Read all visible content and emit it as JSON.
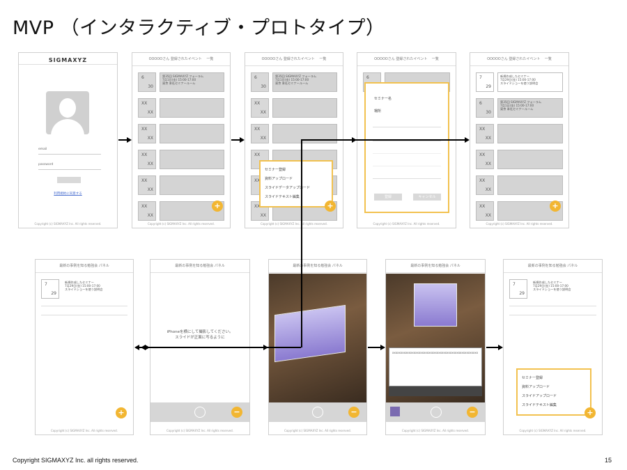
{
  "slide": {
    "title": "MVP （インタラクティブ・プロトタイプ）",
    "footer": "Copyright SIGMAXYZ Inc. all rights reserved.",
    "page_number": "15"
  },
  "login": {
    "logo": "SIGMAXYZ",
    "email_label": "email",
    "password_label": "password",
    "link": "利用規約に同意する",
    "copyright": "Copyright (c) SIGMAXYZ Inc. All rights reserved."
  },
  "list_screen": {
    "header": "OOOOOさん 登録されたイベント 　一覧",
    "event1": {
      "month": "6",
      "day": "30",
      "text": "第35回 SIGMAXYZ フォーラム\n7月1日(金) 15:00-17:00\n東京 本社セミナールーム"
    },
    "placeholder": {
      "month": "XX",
      "day": "XX"
    },
    "fab": "+",
    "copyright": "Copyright (c) SIGMAXYZ Inc. All rights reserved."
  },
  "menu_popup": {
    "items": [
      "セミナー登録",
      "資料アップロード",
      "スライドデータアップロード",
      "スライドテキスト編集"
    ]
  },
  "form_screen": {
    "label1": "セミナー名",
    "label2": "場所",
    "btn_ok": "登録",
    "btn_cancel": "キャンセル"
  },
  "list_screen_2": {
    "header": "OOOOOさん 登録されたイベント 　一覧",
    "event0": {
      "month": "7",
      "day": "29",
      "text": "新規作成したセミナー\n7月29日(金) 15:00-17:00\nスライドショーを使う説明会"
    },
    "event1": {
      "month": "6",
      "day": "30",
      "text": "第35回 SIGMAXYZ フォーラム\n7月1日(金) 15:00-17:00\n東京 本社セミナールーム"
    }
  },
  "detail_screen": {
    "header": "最新の事例を知る勉強会 パネル",
    "event": {
      "month": "7",
      "day": "29",
      "text": "新規作成したセミナー\n7月29日(金) 15:00-17:00\nスライドショーを使う説明会"
    },
    "fab": "+",
    "copyright": "Copyright (c) SIGMAXYZ Inc. All rights reserved."
  },
  "camera_prompt": {
    "header": "最新の事例を知る勉強会 パネル",
    "message": "iPhoneを横にして撮影してください。\nスライドが正面に写るように",
    "fab": "−"
  },
  "camera_live": {
    "header": "最新の事例を知る勉強会 パネル",
    "fab": "−"
  },
  "camera_edit": {
    "header": "最新の事例を知る勉強会 パネル",
    "text": "xxxxxxxxxxxxxxxxxxxxxxxxxxxxxxxxxxxxxxxxxxxxxxxxxxxx",
    "fab": "−"
  },
  "menu_screen": {
    "header": "最新の事例を知る勉強会 パネル",
    "items": [
      "セミナー登録",
      "資料アップロード",
      "スライドアップロード",
      "スライドテキスト編集"
    ],
    "fab": "+"
  }
}
